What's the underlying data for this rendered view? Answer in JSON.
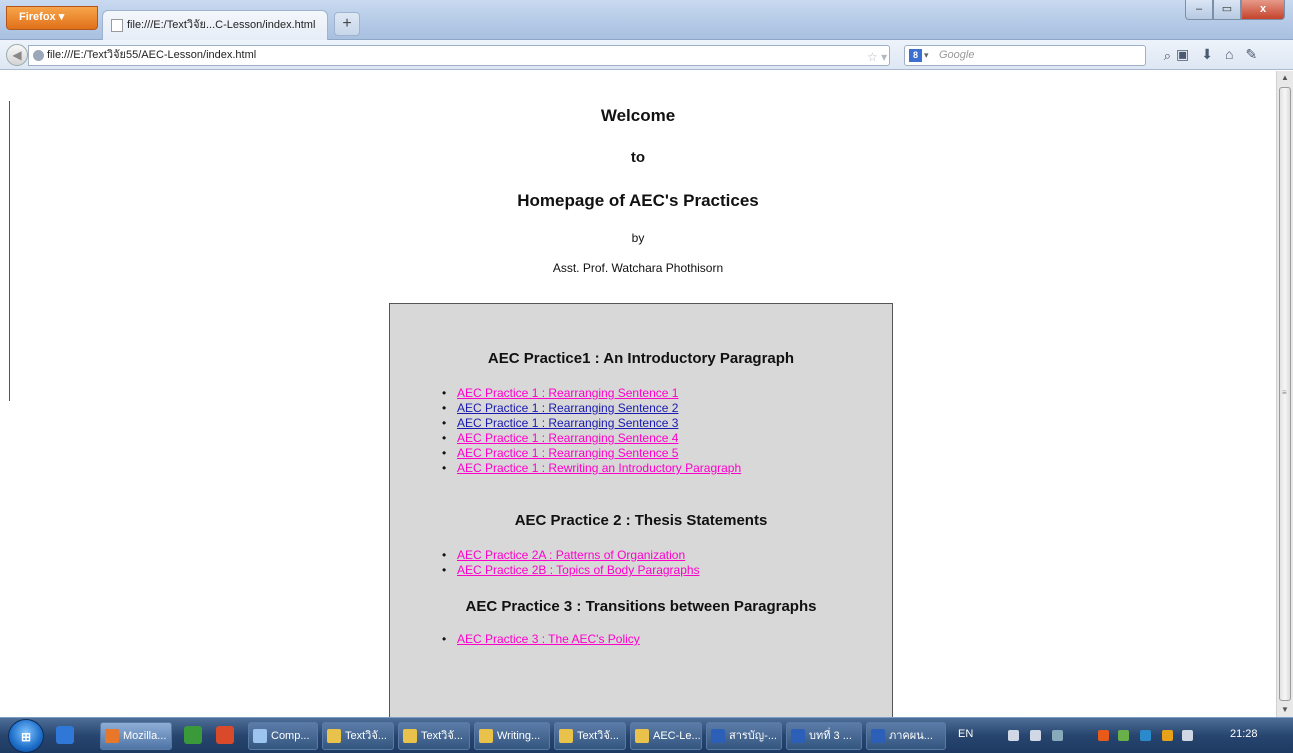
{
  "browser": {
    "app_button": "Firefox",
    "tab_title": "file:///E:/Textวิจัย...C-Lesson/index.html",
    "new_tab": "+",
    "url": "file:///E:/Textวิจัย55/AEC-Lesson/index.html",
    "search_placeholder": "Google",
    "search_engine": "8",
    "window_controls": {
      "minimize": "–",
      "maximize": "▭",
      "close": "x"
    }
  },
  "page": {
    "heading_welcome": "Welcome",
    "heading_to": "to",
    "heading_home": "Homepage of AEC's Practices",
    "by": "by",
    "author": "Asst. Prof. Watchara Phothisorn",
    "sections": [
      {
        "title": "AEC Practice1 : An Introductory Paragraph",
        "links": [
          {
            "label": "AEC Practice 1 : Rearranging Sentence 1",
            "color": "#ff00cc"
          },
          {
            "label": "AEC Practice 1 : Rearranging Sentence 2",
            "color": "#1a1ab0"
          },
          {
            "label": "AEC Practice 1 : Rearranging Sentence 3",
            "color": "#1a1ab0"
          },
          {
            "label": "AEC Practice 1 : Rearranging Sentence 4",
            "color": "#ff00cc"
          },
          {
            "label": "AEC Practice 1 : Rearranging Sentence 5",
            "color": "#ff00cc"
          },
          {
            "label": "AEC Practice 1 : Rewriting an Introductory Paragraph",
            "color": "#ff00cc"
          }
        ]
      },
      {
        "title": "AEC Practice 2 : Thesis Statements",
        "links": [
          {
            "label": "AEC Practice 2A : Patterns of Organization",
            "color": "#ff00cc"
          },
          {
            "label": "AEC Practice 2B : Topics of Body Paragraphs",
            "color": "#ff00cc"
          }
        ]
      },
      {
        "title": "AEC Practice 3 : Transitions between Paragraphs",
        "links": [
          {
            "label": "AEC Practice 3 : The AEC's Policy",
            "color": "#ff00cc"
          }
        ]
      }
    ]
  },
  "taskbar": {
    "items": [
      {
        "label": "Mozilla...",
        "icon": "firefox-icon"
      },
      {
        "label": "Comp...",
        "icon": "computer-icon"
      },
      {
        "label": "Textวิจั...",
        "icon": "folder-icon"
      },
      {
        "label": "Textวิจั...",
        "icon": "folder-icon"
      },
      {
        "label": "Writing...",
        "icon": "folder-icon"
      },
      {
        "label": "Textวิจั...",
        "icon": "folder-icon"
      },
      {
        "label": "AEC-Le...",
        "icon": "folder-icon"
      },
      {
        "label": "สารบัญ-...",
        "icon": "word-icon"
      },
      {
        "label": "บทที่ 3 ...",
        "icon": "word-icon"
      },
      {
        "label": "ภาคผน...",
        "icon": "word-icon"
      }
    ],
    "language": "EN",
    "clock": "21:28"
  }
}
